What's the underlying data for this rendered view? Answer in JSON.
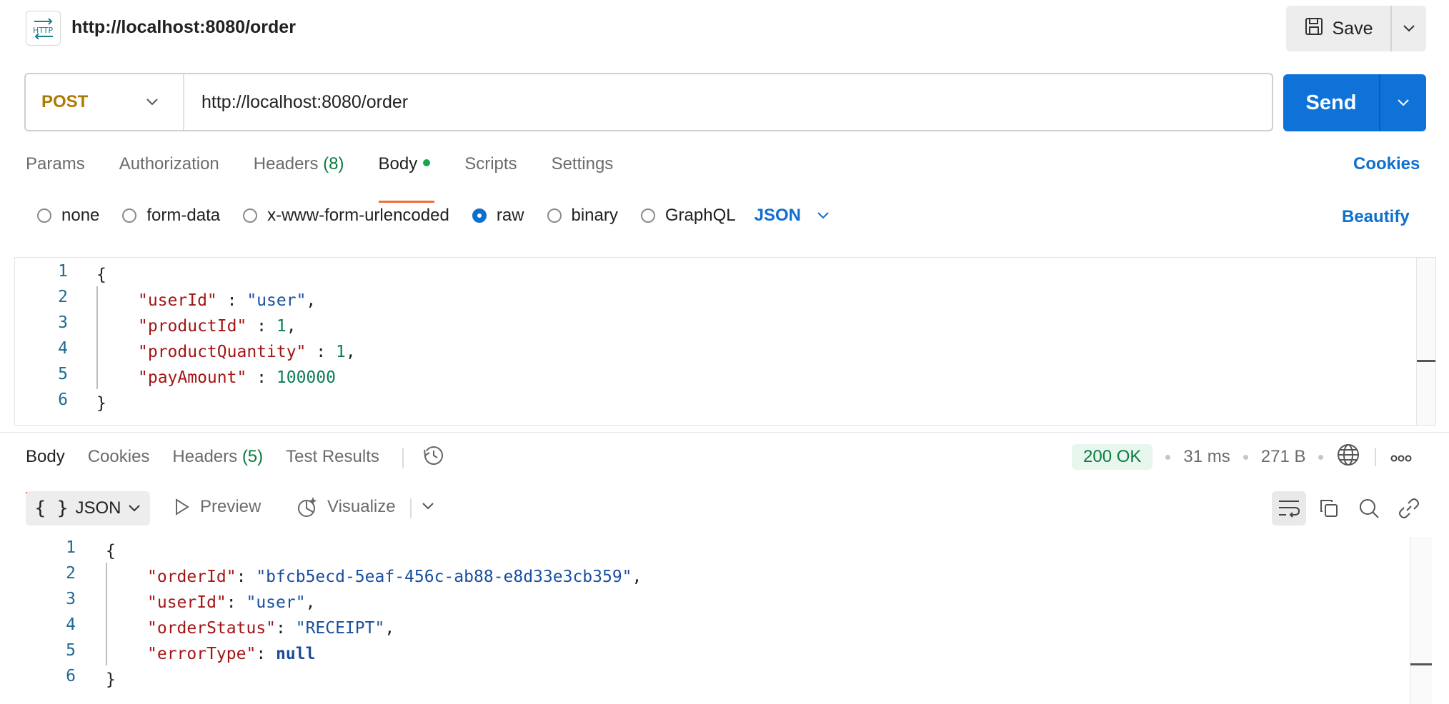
{
  "header": {
    "request_title": "http://localhost:8080/order",
    "save_label": "Save"
  },
  "url_bar": {
    "method": "POST",
    "url": "http://localhost:8080/order",
    "send_label": "Send"
  },
  "request_tabs": [
    {
      "label": "Params"
    },
    {
      "label": "Authorization"
    },
    {
      "label": "Headers",
      "count": "(8)"
    },
    {
      "label": "Body"
    },
    {
      "label": "Scripts"
    },
    {
      "label": "Settings"
    }
  ],
  "cookies_label": "Cookies",
  "body_modes": [
    "none",
    "form-data",
    "x-www-form-urlencoded",
    "raw",
    "binary",
    "GraphQL"
  ],
  "body_format": "JSON",
  "beautify_label": "Beautify",
  "request_body_lines": [
    "1",
    "2",
    "3",
    "4",
    "5",
    "6"
  ],
  "request_body": {
    "open": "{",
    "close": "}",
    "k1": "\"userId\"",
    "v1": "\"user\"",
    "k2": "\"productId\"",
    "v2": "1",
    "k3": "\"productQuantity\"",
    "v3": "1",
    "k4": "\"payAmount\"",
    "v4": "100000",
    "sep": " : ",
    "comma": ","
  },
  "response_tabs": [
    {
      "label": "Body"
    },
    {
      "label": "Cookies"
    },
    {
      "label": "Headers",
      "count": "(5)"
    },
    {
      "label": "Test Results"
    }
  ],
  "response_status": {
    "status": "200 OK",
    "time": "31 ms",
    "size": "271 B"
  },
  "response_toolbar": {
    "format": "JSON",
    "preview": "Preview",
    "visualize": "Visualize"
  },
  "response_body": {
    "open": "{",
    "close": "}",
    "k1": "\"orderId\"",
    "v1": "\"bfcb5ecd-5eaf-456c-ab88-e8d33e3cb359\"",
    "k2": "\"userId\"",
    "v2": "\"user\"",
    "k3": "\"orderStatus\"",
    "v3": "\"RECEIPT\"",
    "k4": "\"errorType\"",
    "v4": "null",
    "sep": ": ",
    "comma": ","
  },
  "colors": {
    "accent": "#0f72d9",
    "method": "#ad7a03",
    "tab_underline": "#f26b3a",
    "status_ok": "#0a7a3f"
  }
}
